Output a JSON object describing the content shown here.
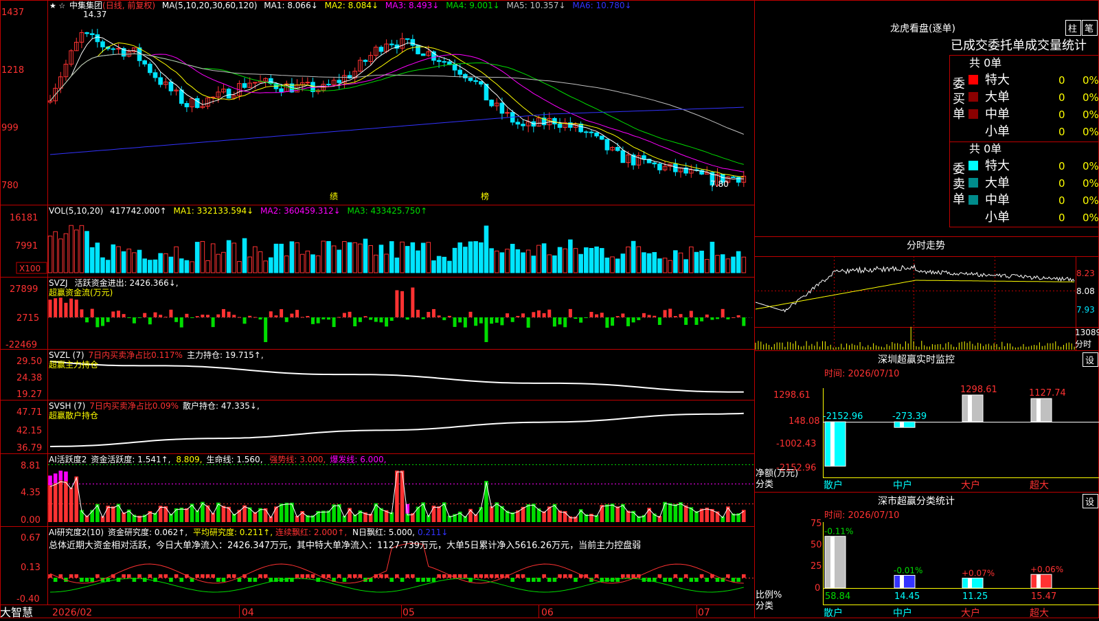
{
  "colors": {
    "bg": "#000000",
    "frame": "#c00000",
    "up": "#ff3232",
    "down": "#00e5ff",
    "cyan": "#00ffff",
    "yellow": "#ffff00",
    "magenta": "#ff00ff",
    "green": "#00dd00",
    "white": "#ffffff",
    "blue": "#3333ff",
    "gray": "#c0c0c0"
  },
  "app": {
    "brand": "大智慧",
    "stars": "★ ☆"
  },
  "main": {
    "name": "中集集团",
    "mode": "(日线, 前复权)",
    "ma_label": "MA(5,10,20,30,60,120)",
    "ma1": "MA1: 8.066↓",
    "ma2": "MA2: 8.084↓",
    "ma3": "MA3: 8.493↓",
    "ma4": "MA4: 9.001↓",
    "ma5": "MA5: 10.357↓",
    "ma6": "MA6: 10.780↓",
    "y_labels": [
      "1437",
      "1218",
      "999",
      "780"
    ],
    "high_mark": "14.37",
    "low_mark": "7.80",
    "tag1": "绩",
    "tag2": "榜"
  },
  "vol": {
    "label": "VOL(5,10,20)",
    "value": "417742.000↑",
    "ma1": "MA1: 332133.594↓",
    "ma2": "MA2: 360459.312↓",
    "ma3": "MA3: 433425.750↑",
    "y_labels": [
      "16181",
      "7991"
    ],
    "unit": "X100"
  },
  "svzj": {
    "label": "SVZJ",
    "desc": "活跃资金进出: 2426.366↓,",
    "sub": "超赢资金流(万元)",
    "y_labels": [
      "27899",
      "2715",
      "-22469"
    ]
  },
  "svzl": {
    "label": "SVZL (7)",
    "desc1": "7日内买卖净占比0.117%",
    "desc2": "主力持仓: 19.715↑,",
    "sub": "超赢主力持仓",
    "y_labels": [
      "29.50",
      "24.38",
      "19.27"
    ]
  },
  "svsh": {
    "label": "SVSH (7)",
    "desc1": "7日内买卖净占比0.09%",
    "desc2": "散户持仓: 47.335↓,",
    "sub": "超赢散户持仓",
    "y_labels": [
      "47.71",
      "42.15",
      "36.79"
    ]
  },
  "ai2": {
    "label": "AI活跃度2",
    "t1": "资金活跃度: 1.541↑,",
    "t2": "8.809,",
    "t3": "生命线: 1.560,",
    "t4": "强势线: 3.000,",
    "t5": "爆发线: 6.000,",
    "y_labels": [
      "8.81",
      "4.35",
      "0.00"
    ]
  },
  "ai3": {
    "label": "AI研究度2(10)",
    "t1": "资金研究度: 0.062↑,",
    "t2": "平均研究度: 0.211↑,",
    "t3": "连续飘红: 2.000↑,",
    "t4": "N日飘红: 5.000,",
    "t5": "0.211↓",
    "summary": "总体近期大资金相对活跃，今日大单净流入：2426.347万元，其中特大单净流入：1127.739万元，大单5日累计净入5616.26万元，当前主力控盘弱",
    "y_labels": [
      "0.67",
      "0.13",
      "-0.40"
    ]
  },
  "x_axis": [
    "2026/02",
    "04",
    "05",
    "06",
    "07"
  ],
  "lhb": {
    "title": "龙虎看盘(逐单)",
    "btn1": "柱",
    "btn2": "笔",
    "subtitle": "已成交委托单成交量统计",
    "buy_side": "委买单",
    "sell_side": "委卖单",
    "buy_total": "共 0单",
    "sell_total": "共 0单",
    "buy_rows": [
      {
        "label": "特大",
        "count": "0",
        "pct": "0%"
      },
      {
        "label": "大单",
        "count": "0",
        "pct": "0%"
      },
      {
        "label": "中单",
        "count": "0",
        "pct": "0%"
      },
      {
        "label": "小单",
        "count": "0",
        "pct": "0%"
      }
    ],
    "sell_rows": [
      {
        "label": "特大",
        "count": "0",
        "pct": "0%"
      },
      {
        "label": "大单",
        "count": "0",
        "pct": "0%"
      },
      {
        "label": "中单",
        "count": "0",
        "pct": "0%"
      },
      {
        "label": "小单",
        "count": "0",
        "pct": "0%"
      }
    ]
  },
  "intraday": {
    "title": "分时走势",
    "prices": [
      "8.23",
      "8.08",
      "7.93"
    ],
    "vol_label": "13089",
    "unit": "分时"
  },
  "sz_monitor": {
    "title": "深圳超赢实时监控",
    "btn": "设",
    "time": "时间: 2026/07/10",
    "y_labels": [
      "1298.61",
      "148.08",
      "-1002.43",
      "-2152.96"
    ],
    "axis_label1": "净额(万元)",
    "axis_label2": "分类",
    "cats": [
      "散户",
      "中户",
      "大户",
      "超大"
    ],
    "values": [
      "-2152.96",
      "-273.39",
      "1298.61",
      "1127.74"
    ]
  },
  "sz_class": {
    "title": "深市超赢分类统计",
    "btn": "设",
    "time": "时间: 2026/07/10",
    "y_labels": [
      "75",
      "50",
      "25",
      "0"
    ],
    "axis_label1": "比例%",
    "axis_label2": "分类",
    "cats": [
      "散户",
      "中户",
      "大户",
      "超大"
    ],
    "changes": [
      "-0.11%",
      "-0.01%",
      "+0.07%",
      "+0.06%"
    ],
    "values": [
      "58.84",
      "14.45",
      "11.25",
      "15.47"
    ]
  }
}
